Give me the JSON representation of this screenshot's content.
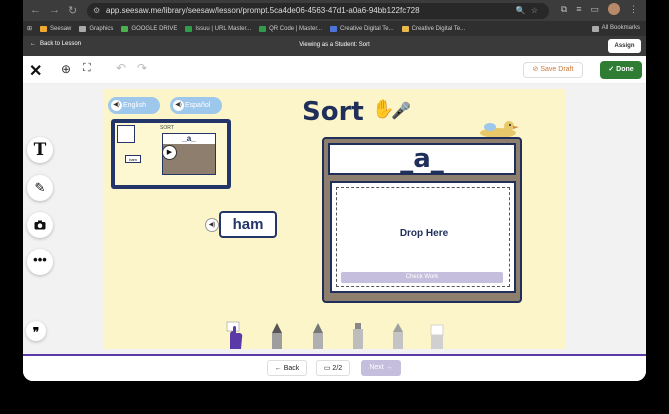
{
  "browser": {
    "url": "app.seesaw.me/library/seesaw/lesson/prompt.5ca4de06-4563-47d1-a0a6-94bb122fc728",
    "bookmarks": [
      {
        "label": "Seesaw",
        "color": "#f0a830"
      },
      {
        "label": "Graphics",
        "color": "#aaaaaa"
      },
      {
        "label": "GOOGLE DRIVE",
        "color": "#4caf50"
      },
      {
        "label": "Issuu | URL Master...",
        "color": "#2e9c48"
      },
      {
        "label": "QR Code | Master...",
        "color": "#2e9c48"
      },
      {
        "label": "Creative Digital Te...",
        "color": "#4a74d9"
      },
      {
        "label": "Creative Digital Te...",
        "color": "#e8b84a"
      }
    ],
    "all_bookmarks": "All Bookmarks"
  },
  "student_bar": {
    "back_label": "Back to Lesson",
    "title": "Viewing as a Student: Sort",
    "assign_label": "Assign"
  },
  "toolbar": {
    "save_draft_label": "Save Draft",
    "done_label": "Done"
  },
  "activity": {
    "lang_english": "English",
    "lang_espanol": "Español",
    "title": "Sort",
    "word_card": "ham",
    "sort_heading": "_a_",
    "drop_label": "Drop Here",
    "check_work_label": "Check Work",
    "mini_sort_label": "SORT",
    "mini_heading": "_a_",
    "mini_word": "ham"
  },
  "footer": {
    "back_label": "Back",
    "page_indicator": "2/2",
    "next_label": "Next"
  },
  "colors": {
    "canvas_bg": "#fbf5c9",
    "navy": "#1f2f5a",
    "done_green": "#2e7d32",
    "save_orange": "#c9793a",
    "purple": "#5b3aa8"
  }
}
